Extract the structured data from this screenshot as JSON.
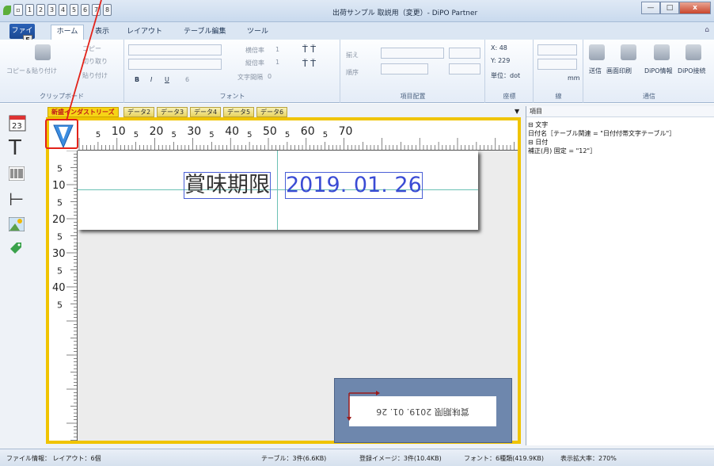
{
  "window": {
    "title": "出荷サンプル 取説用（変更）- DiPO Partner",
    "qat_numbers": [
      "1",
      "2",
      "3",
      "4",
      "5",
      "6",
      "7",
      "8"
    ],
    "buttons": {
      "minimize": "—",
      "maximize": "□",
      "close": "x"
    }
  },
  "ribbon_tabs": {
    "file": "ファイル",
    "file_keytip": "F",
    "home": "ホーム",
    "view": "表示",
    "layout": "レイアウト",
    "table_edit": "テーブル編集",
    "tools": "ツール"
  },
  "ribbon": {
    "clipboard": {
      "label": "クリップボード",
      "copy_paste": "コピー＆貼り付け",
      "copy": "コピー",
      "cut": "切り取り",
      "paste": "貼り付け"
    },
    "font": {
      "label": "フォント",
      "hscale_label": "横倍率",
      "hscale_value": "1",
      "vscale_label": "縦倍率",
      "vscale_value": "1",
      "spacing_label": "文字間隔",
      "spacing_value": "0",
      "size_value": "6"
    },
    "arrange": {
      "label": "項目配置",
      "align": "揃え",
      "order": "順序"
    },
    "coords": {
      "label": "座標",
      "x": "X: 48",
      "y": "Y: 229",
      "unit": "単位：dot"
    },
    "line": {
      "label": "線",
      "unit": "mm"
    },
    "comm": {
      "label": "通信",
      "send": "送信",
      "screen_print": "画面印刷",
      "dipo_info": "DiPO情報",
      "dipo_connect": "DiPO接続"
    }
  },
  "doc_tabs": [
    {
      "label": "新盛インダストリーズ",
      "active": true
    },
    {
      "label": "データ2",
      "active": false
    },
    {
      "label": "データ3",
      "active": false
    },
    {
      "label": "データ4",
      "active": false
    },
    {
      "label": "データ5",
      "active": false
    },
    {
      "label": "データ6",
      "active": false
    }
  ],
  "ruler": {
    "top_major": [
      "5",
      "10",
      "5",
      "20",
      "5",
      "30",
      "5",
      "40",
      "5",
      "50",
      "5",
      "60",
      "5",
      "70"
    ],
    "left_major": [
      "5",
      "10",
      "5",
      "20",
      "5",
      "30",
      "5",
      "40",
      "5"
    ]
  },
  "canvas": {
    "field_label": "賞味期限",
    "field_date": "2019. 01. 26",
    "preview_text": "賞味期限 2019. 01. 26"
  },
  "right_panel": {
    "title": "項目",
    "tree": [
      "⊟ 文字",
      "    日付名［テーブル関連 = \"日付付帯文字テーブル\"］",
      "⊟ 日付",
      "    補正(月) 固定 = \"12\"］"
    ]
  },
  "status": {
    "file_info": "ファイル情報： レイアウト：6個",
    "table": "テーブル：3件(6.6KB)",
    "images": "登録イメージ：3件(10.4KB)",
    "fonts": "フォント：6種類(419.9KB)",
    "zoom": "表示拡大率：270%"
  },
  "colors": {
    "highlight": "#f0c400",
    "annotation": "#e2231a",
    "field_border": "#4a5fd6"
  }
}
